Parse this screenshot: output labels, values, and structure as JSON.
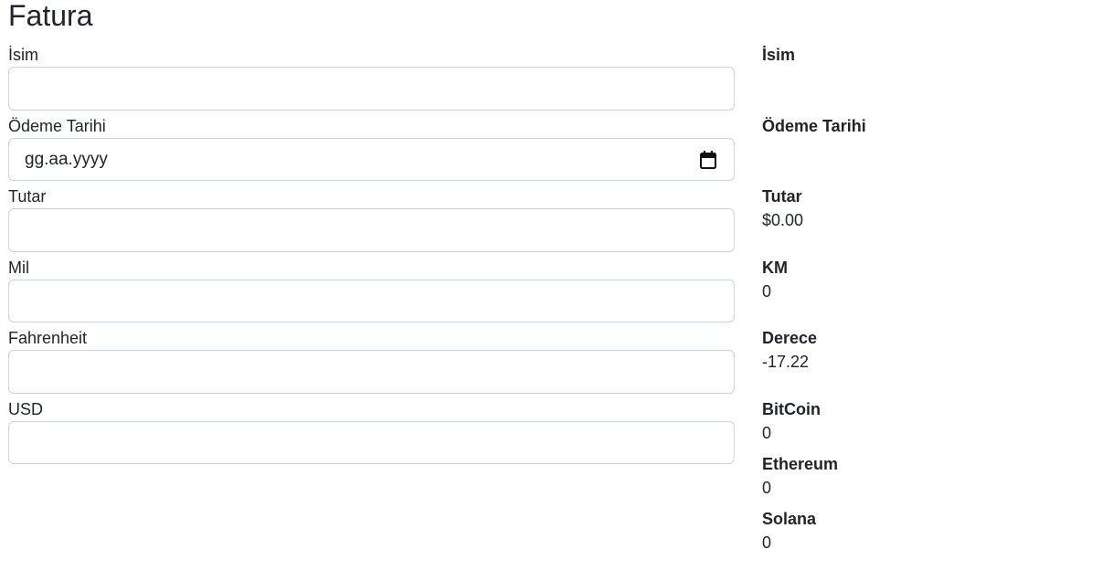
{
  "page": {
    "title": "Fatura"
  },
  "form": {
    "name_label": "İsim",
    "name_value": "",
    "date_label": "Ödeme Tarihi",
    "date_placeholder": "gg.aa.yyyy",
    "amount_label": "Tutar",
    "amount_value": "",
    "mile_label": "Mil",
    "mile_value": "",
    "fahrenheit_label": "Fahrenheit",
    "fahrenheit_value": "",
    "usd_label": "USD",
    "usd_value": ""
  },
  "output": {
    "name_label": "İsim",
    "name_value": "",
    "date_label": "Ödeme Tarihi",
    "date_value": "",
    "amount_label": "Tutar",
    "amount_value": "$0.00",
    "km_label": "KM",
    "km_value": "0",
    "celsius_label": "Derece",
    "celsius_value": "-17.22",
    "bitcoin_label": "BitCoin",
    "bitcoin_value": "0",
    "ethereum_label": "Ethereum",
    "ethereum_value": "0",
    "solana_label": "Solana",
    "solana_value": "0"
  },
  "icons": {
    "date_picker": "calendar-icon"
  }
}
